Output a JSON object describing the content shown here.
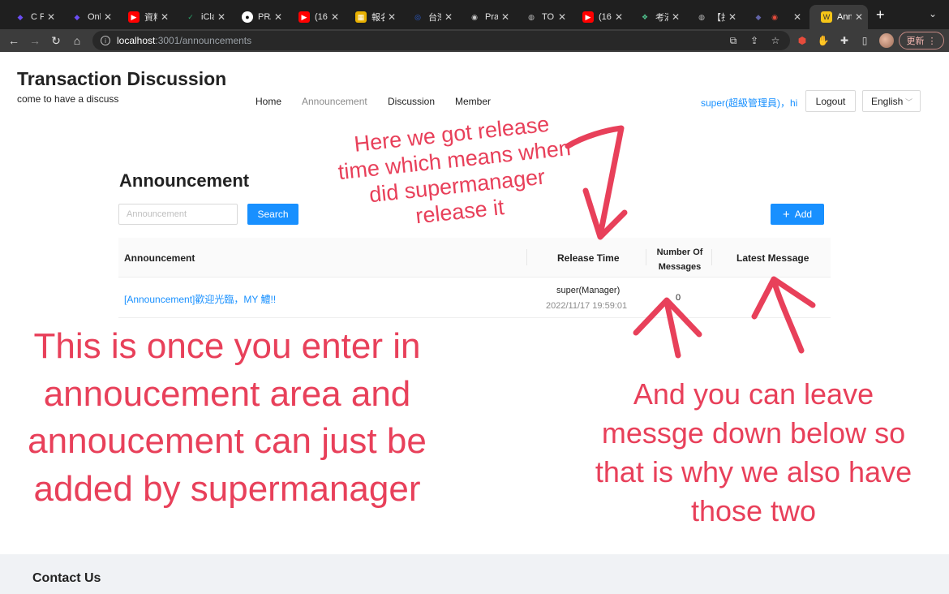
{
  "browser": {
    "tabs": [
      {
        "title": "C Pr",
        "icon": "prisma-icon",
        "color": "#6b4df5"
      },
      {
        "title": "Onli",
        "icon": "prisma-icon",
        "color": "#6b4df5"
      },
      {
        "title": "資料",
        "icon": "youtube-icon",
        "color": "#ff0000"
      },
      {
        "title": "iCla",
        "icon": "iclass-icon",
        "color": "#2aa56a"
      },
      {
        "title": "PRA",
        "icon": "github-icon",
        "color": "#ffffff"
      },
      {
        "title": "(16",
        "icon": "youtube-icon",
        "color": "#ff0000"
      },
      {
        "title": "報名",
        "icon": "image-icon",
        "color": "#e8b000"
      },
      {
        "title": "台灣",
        "icon": "orbit-icon",
        "color": "#2b5fd9"
      },
      {
        "title": "Prac",
        "icon": "ets-icon",
        "color": "#cccccc"
      },
      {
        "title": "TOE",
        "icon": "globe-icon",
        "color": "#bbbbbb"
      },
      {
        "title": "(16",
        "icon": "youtube-icon",
        "color": "#ff0000"
      },
      {
        "title": "考滿",
        "icon": "leaf-icon",
        "color": "#4fc08d"
      },
      {
        "title": "【找",
        "icon": "globe-icon",
        "color": "#bbbbbb"
      },
      {
        "title": "",
        "icon": "teams-icon",
        "color": "#6264a7"
      },
      {
        "title": "Ann",
        "icon": "site-icon",
        "color": "#f5c518"
      }
    ],
    "new_tab_label": "+",
    "url_host": "localhost",
    "url_path": ":3001/announcements",
    "update_label": "更新"
  },
  "header": {
    "title": "Transaction Discussion",
    "subtitle": "come to have a discuss",
    "nav": [
      "Home",
      "Announcement",
      "Discussion",
      "Member"
    ],
    "user": "super(超級管理員)，hi",
    "logout_label": "Logout",
    "language": "English"
  },
  "main": {
    "heading": "Announcement",
    "search_placeholder": "Announcement",
    "search_label": "Search",
    "add_label": "Add",
    "columns": [
      "Announcement",
      "Release Time",
      "Number Of Messages",
      "Latest Message"
    ],
    "rows": [
      {
        "title": "[Announcement]歡迎光臨，MY 鱧!!",
        "author": "super(Manager)",
        "time": "2022/11/17 19:59:01",
        "messages": "0",
        "latest": ""
      }
    ]
  },
  "footer": {
    "title": "Contact Us"
  },
  "annotations": {
    "release_time": "Here we got release time which means when did supermanager release it",
    "announcement_area": "This is once you enter in annoucement area and annoucement can just be added by supermanager",
    "messages": "And you can leave messge down below so that is why we also have those two"
  },
  "colors": {
    "accent": "#1890ff",
    "annotation": "#e8405a",
    "chrome_dark": "#1f1f1f"
  }
}
